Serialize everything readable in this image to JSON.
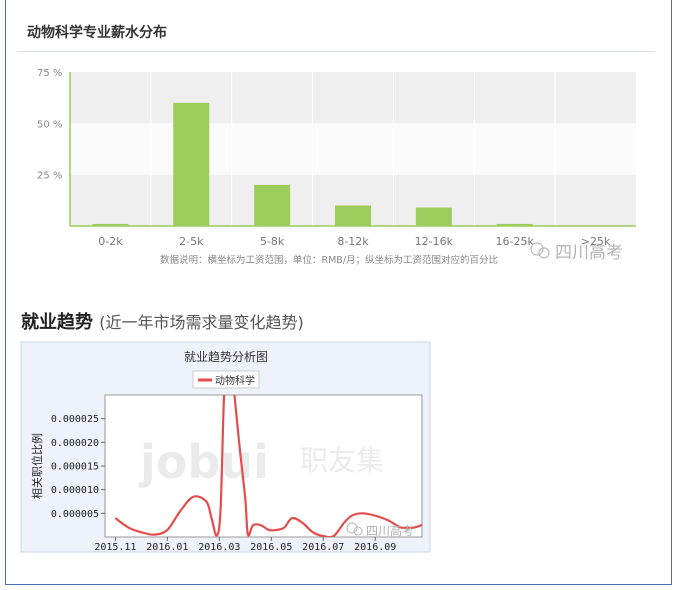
{
  "salary_section": {
    "title": "动物科学专业薪水分布",
    "note": "数据说明：横坐标为工资范围，单位：RMB/月；纵坐标为工资范围对应的百分比"
  },
  "trend_section": {
    "title": "就业趋势",
    "subtitle": "(近一年市场需求量变化趋势)"
  },
  "watermarks": {
    "account": "四川高考",
    "brand_latin": "jobui",
    "brand_cn": "职友集"
  },
  "colors": {
    "bar": "#9ccc5c",
    "line": "#e74c4c",
    "trend_bg": "#eef2fb"
  },
  "chart_data": [
    {
      "type": "bar",
      "title": "",
      "categories": [
        "0-2k",
        "2-5k",
        "5-8k",
        "8-12k",
        "12-16k",
        "16-25k",
        ">25k"
      ],
      "values": [
        1,
        60,
        20,
        10,
        9,
        1,
        0
      ],
      "yticks": [
        "75 %",
        "50 %",
        "25 %"
      ],
      "ylim": [
        0,
        75
      ],
      "grid": "banded"
    },
    {
      "type": "line",
      "title": "就业趋势分析图",
      "ylabel": "相关职位比例",
      "legend": "top-center",
      "series": [
        {
          "name": "动物科学",
          "x": [
            0,
            0.5,
            1,
            1.5,
            2,
            2.5,
            3,
            3.5,
            3.7,
            3.9,
            4.05,
            4.2,
            4.4,
            4.55,
            4.6,
            4.8,
            5,
            5.1,
            5.3,
            5.6,
            5.9,
            6.2,
            6.5,
            6.8,
            7.2,
            7.6,
            8,
            8.4,
            8.8,
            9.1,
            9.5,
            10,
            10.5,
            11,
            11.5,
            12
          ],
          "values": [
            4e-06,
            2e-06,
            1e-06,
            5e-07,
            1.5e-06,
            5.5e-06,
            8.5e-06,
            7.5e-06,
            4e-06,
            3e-07,
            6e-06,
            3.2e-05,
            3.5e-05,
            3.2e-05,
            2.9e-05,
            1.8e-05,
            8e-06,
            5e-07,
            2.5e-06,
            2.5e-06,
            1.5e-06,
            1.5e-06,
            2e-06,
            4e-06,
            3e-06,
            1e-06,
            2e-07,
            2e-07,
            3e-06,
            4.5e-06,
            5e-06,
            4.5e-06,
            3.5e-06,
            2e-06,
            2e-06,
            3e-06
          ]
        }
      ],
      "xticks": [
        "2015.11",
        "2016.01",
        "2016.03",
        "2016.05",
        "2016.07",
        "2016.09"
      ],
      "xtick_pos": [
        0,
        2,
        4,
        6,
        8,
        10
      ],
      "xlim": [
        -0.4,
        11.8
      ],
      "yticks": [
        "0.000005",
        "0.000010",
        "0.000015",
        "0.000020",
        "0.000025"
      ],
      "ytick_values": [
        5e-06,
        1e-05,
        1.5e-05,
        2e-05,
        2.5e-05
      ],
      "ylim": [
        0,
        3e-05
      ]
    }
  ]
}
